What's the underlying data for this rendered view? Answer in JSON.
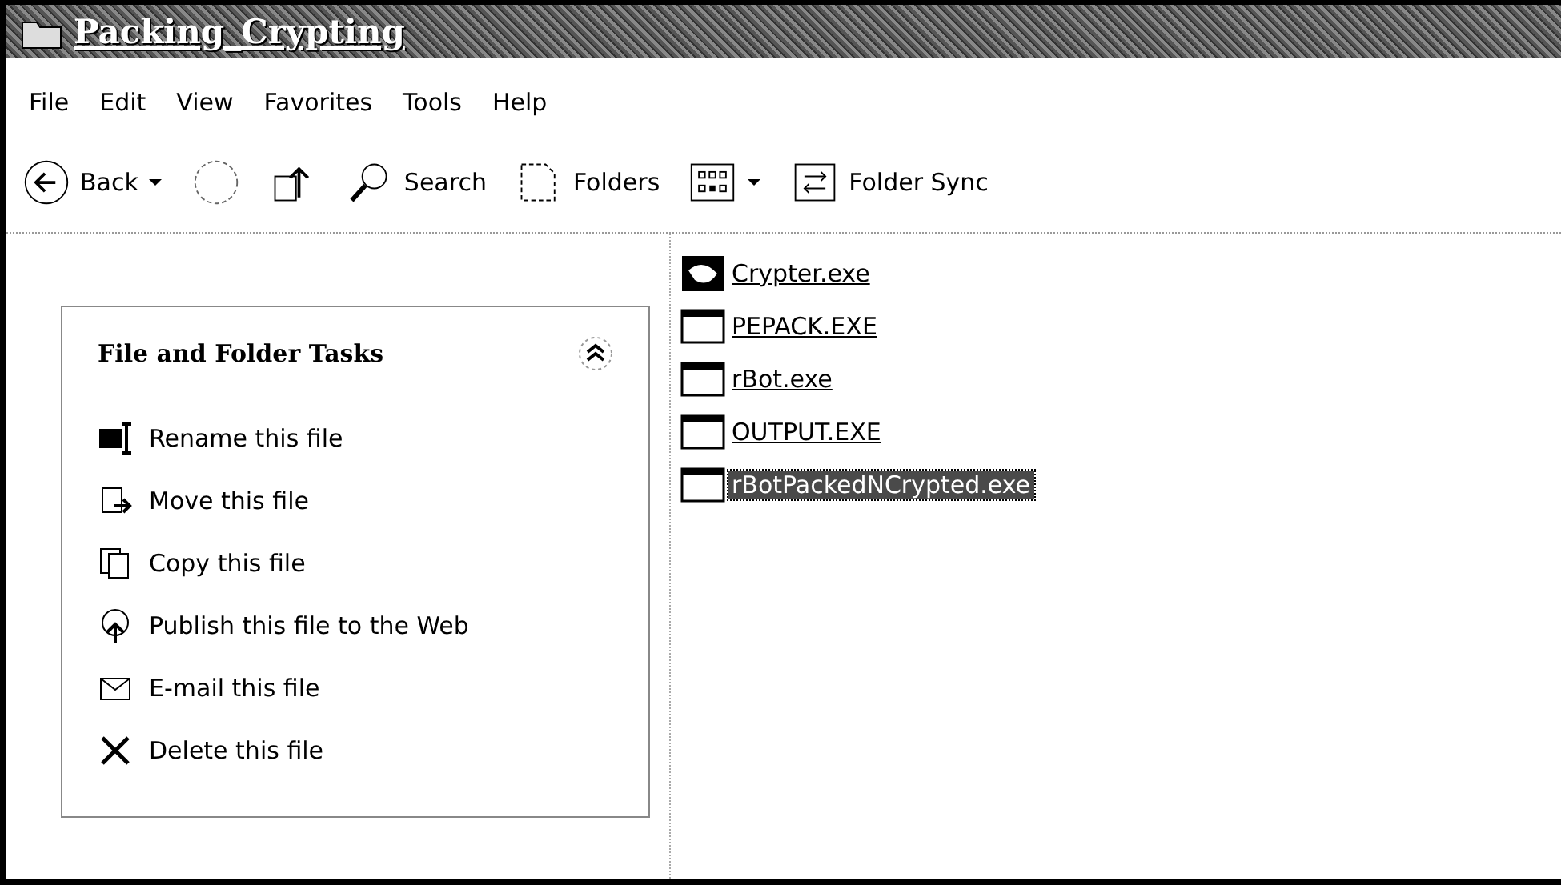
{
  "window": {
    "title": "Packing_Crypting"
  },
  "menu": [
    "File",
    "Edit",
    "View",
    "Favorites",
    "Tools",
    "Help"
  ],
  "toolbar": [
    {
      "kind": "back",
      "label": "Back",
      "dropdown": true
    },
    {
      "kind": "forward",
      "dropdown": false
    },
    {
      "kind": "up",
      "dropdown": false
    },
    {
      "kind": "search",
      "label": "Search",
      "dropdown": false
    },
    {
      "kind": "folders",
      "label": "Folders",
      "dropdown": false
    },
    {
      "kind": "views",
      "dropdown": true
    },
    {
      "kind": "sync",
      "label": "Folder Sync",
      "dropdown": false
    }
  ],
  "tasks_panel": {
    "title": "File and Folder Tasks",
    "expanded": true,
    "items": [
      {
        "kind": "rename",
        "label": "Rename this file"
      },
      {
        "kind": "move",
        "label": "Move this file"
      },
      {
        "kind": "copy",
        "label": "Copy this file"
      },
      {
        "kind": "publish",
        "label": "Publish this file to the Web"
      },
      {
        "kind": "email",
        "label": "E-mail this file"
      },
      {
        "kind": "delete",
        "label": "Delete this file"
      }
    ]
  },
  "files": [
    {
      "name": "Crypter.exe",
      "kind": "custom",
      "selected": false
    },
    {
      "name": "PEPACK.EXE",
      "kind": "program",
      "selected": false
    },
    {
      "name": "rBot.exe",
      "kind": "program",
      "selected": false
    },
    {
      "name": "OUTPUT.EXE",
      "kind": "program",
      "selected": false
    },
    {
      "name": "rBotPackedNCrypted.exe",
      "kind": "program",
      "selected": true
    }
  ]
}
